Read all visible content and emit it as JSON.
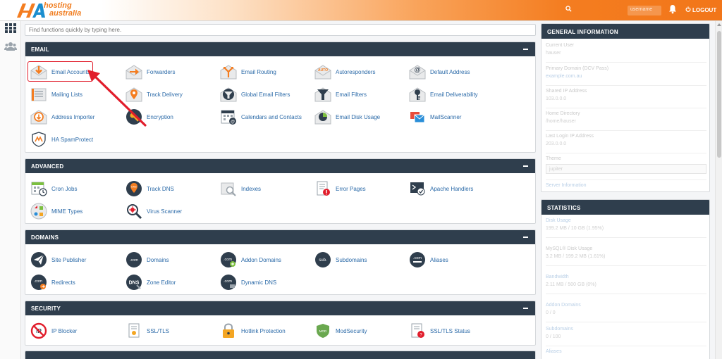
{
  "brand": {
    "name_line1": "hosting",
    "name_line2": "australia",
    "accent": "#f47d20"
  },
  "header": {
    "search_icon": "search-icon",
    "user_menu_label": "username",
    "logout_label": "LOGOUT"
  },
  "search": {
    "placeholder": "Find functions quickly by typing here."
  },
  "sections": {
    "email": {
      "title": "EMAIL",
      "items": [
        "Email Accounts",
        "Forwarders",
        "Email Routing",
        "Autoresponders",
        "Default Address",
        "Mailing Lists",
        "Track Delivery",
        "Global Email Filters",
        "Email Filters",
        "Email Deliverability",
        "Address Importer",
        "Encryption",
        "Calendars and Contacts",
        "Email Disk Usage",
        "MailScanner",
        "HA SpamProtect"
      ]
    },
    "advanced": {
      "title": "ADVANCED",
      "items": [
        "Cron Jobs",
        "Track DNS",
        "Indexes",
        "Error Pages",
        "Apache Handlers",
        "MIME Types",
        "Virus Scanner"
      ]
    },
    "domains": {
      "title": "DOMAINS",
      "items": [
        "Site Publisher",
        "Domains",
        "Addon Domains",
        "Subdomains",
        "Aliases",
        "Redirects",
        "Zone Editor",
        "Dynamic DNS"
      ]
    },
    "security": {
      "title": "SECURITY",
      "items": [
        "IP Blocker",
        "SSL/TLS",
        "Hotlink Protection",
        "ModSecurity",
        "SSL/TLS Status"
      ]
    }
  },
  "general_info": {
    "title": "GENERAL INFORMATION",
    "rows": [
      {
        "label": "Current User",
        "value": "hauser"
      },
      {
        "label": "Primary Domain (DCV Pass)",
        "value": "example.com.au"
      },
      {
        "label": "Shared IP Address",
        "value": "103.0.0.0"
      },
      {
        "label": "Home Directory",
        "value": "/home/hauser"
      },
      {
        "label": "Last Login IP Address",
        "value": "203.0.0.0"
      },
      {
        "label": "Theme",
        "value": "jupiter"
      },
      {
        "label": "Server Information",
        "value": ""
      }
    ]
  },
  "statistics": {
    "title": "STATISTICS",
    "rows": [
      {
        "label": "Disk Usage",
        "value": "199.2 MB / 10 GB (1.95%)"
      },
      {
        "label": "MySQL® Disk Usage",
        "value": "3.2 MB / 199.2 MB (1.61%)"
      },
      {
        "label": "Bandwidth",
        "value": "2.11 MB / 500 GB (0%)"
      },
      {
        "label": "Addon Domains",
        "value": "0 / 0"
      },
      {
        "label": "Subdomains",
        "value": "0 / 100"
      },
      {
        "label": "Aliases",
        "value": ""
      }
    ]
  }
}
